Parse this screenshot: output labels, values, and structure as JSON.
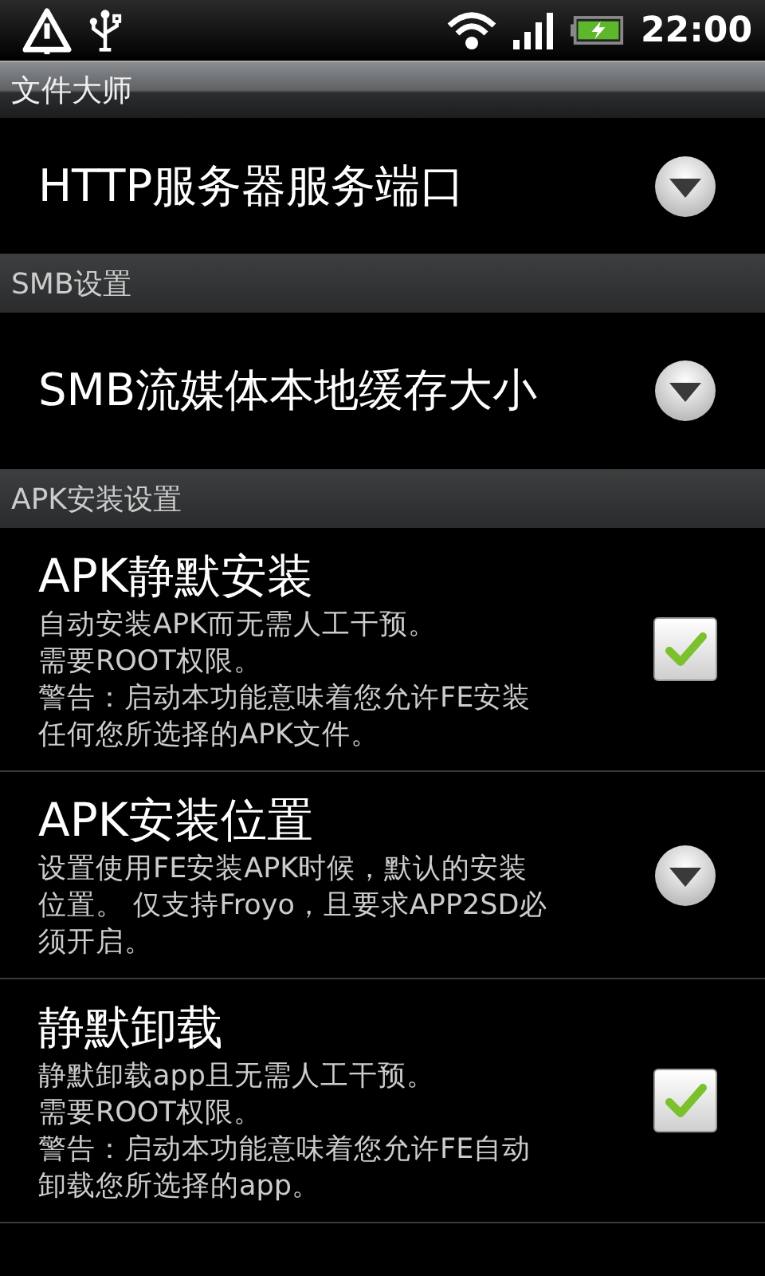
{
  "status_bar": {
    "time": "22:00"
  },
  "title_bar": {
    "title": "文件大师"
  },
  "list": [
    {
      "kind": "dropdown",
      "title": "HTTP服务器服务端口"
    },
    {
      "kind": "header",
      "title": "SMB设置"
    },
    {
      "kind": "dropdown",
      "title": "SMB流媒体本地缓存大小"
    },
    {
      "kind": "header",
      "title": "APK安装设置"
    },
    {
      "kind": "checkbox",
      "title": "APK静默安装",
      "description": [
        "自动安装APK而无需人工干预。",
        "需要ROOT权限。",
        "警告：启动本功能意味着您允许FE安装",
        "任何您所选择的APK文件。"
      ],
      "checked": true
    },
    {
      "kind": "dropdown",
      "title": "APK安装位置",
      "description": [
        "设置使用FE安装APK时候，默认的安装",
        "位置。 仅支持Froyo，且要求APP2SD必",
        "须开启。"
      ]
    },
    {
      "kind": "checkbox",
      "title": "静默卸载",
      "description": [
        "静默卸载app且无需人工干预。",
        "需要ROOT权限。",
        "警告：启动本功能意味着您允许FE自动",
        "卸载您所选择的app。"
      ],
      "checked": true
    }
  ]
}
